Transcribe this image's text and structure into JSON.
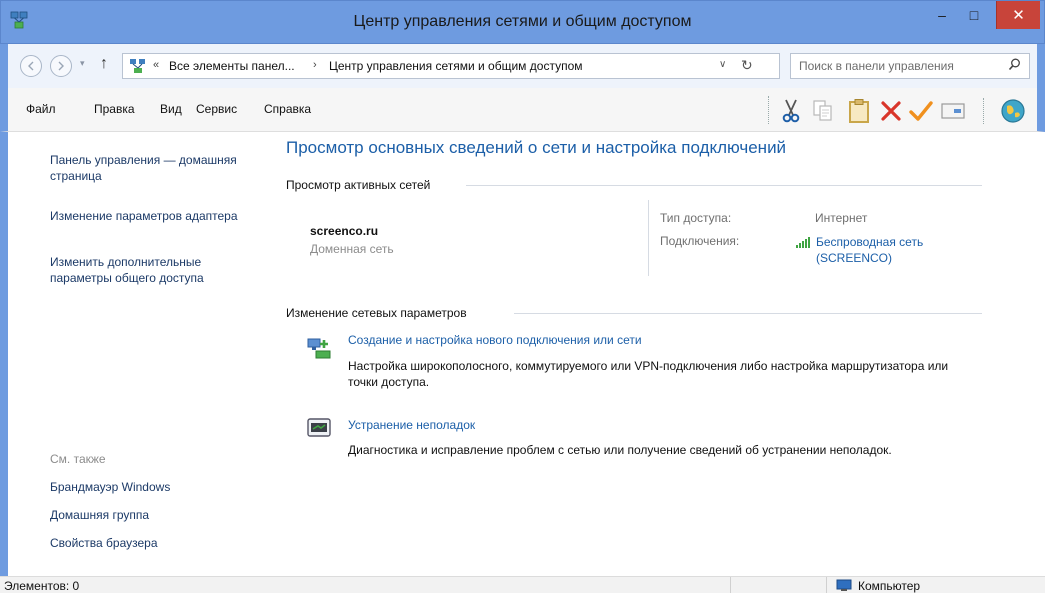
{
  "window": {
    "title": "Центр управления сетями и общим доступом",
    "minimize_glyph": "–",
    "maximize_glyph": "□",
    "close_glyph": "✕"
  },
  "address_bar": {
    "history_glyph": "▾",
    "up_glyph": "↑",
    "overflow": "«",
    "segments": [
      "Все элементы панел...",
      "Центр управления сетями и общим доступом"
    ],
    "separator": "›",
    "dropdown_glyph": "∨",
    "refresh_glyph": "↻"
  },
  "search": {
    "placeholder": "Поиск в панели управления",
    "icon": "search-icon"
  },
  "menu": [
    "Файл",
    "Правка",
    "Вид",
    "Сервис",
    "Справка"
  ],
  "toolbar": {
    "icons": [
      "scissors-icon",
      "copy-icon",
      "paste-icon",
      "delete-icon",
      "check-icon",
      "properties-icon",
      "globe-icon"
    ]
  },
  "sidebar": {
    "home_link": "Панель управления — домашняя страница",
    "links": [
      "Изменение параметров адаптера",
      "Изменить дополнительные параметры общего доступа"
    ],
    "see_also_label": "См. также",
    "see_also_links": [
      "Брандмауэр Windows",
      "Домашняя группа",
      "Свойства браузера"
    ]
  },
  "main": {
    "title": "Просмотр основных сведений о сети и настройка подключений",
    "active_networks": {
      "heading": "Просмотр активных сетей",
      "network_name": "screenco.ru",
      "network_type": "Доменная сеть",
      "access_type_label": "Тип доступа:",
      "access_type_value": "Интернет",
      "connections_label": "Подключения:",
      "connection_name": "Беспроводная сеть (SCREENCO)"
    },
    "change_settings": {
      "heading": "Изменение сетевых параметров",
      "tasks": [
        {
          "icon": "new-connection-icon",
          "title": "Создание и настройка нового подключения или сети",
          "description": "Настройка широкополосного, коммутируемого или VPN-подключения либо настройка маршрутизатора или точки доступа."
        },
        {
          "icon": "troubleshoot-icon",
          "title": "Устранение неполадок",
          "description": "Диагностика и исправление проблем с сетью или получение сведений об устранении неполадок."
        }
      ]
    }
  },
  "status_bar": {
    "items_count": "Элементов: 0",
    "location": "Компьютер"
  },
  "colors": {
    "frame": "#6e9be0",
    "link": "#1c5fa8",
    "close_button": "#c8443a",
    "title_link": "#1c5fa8"
  }
}
